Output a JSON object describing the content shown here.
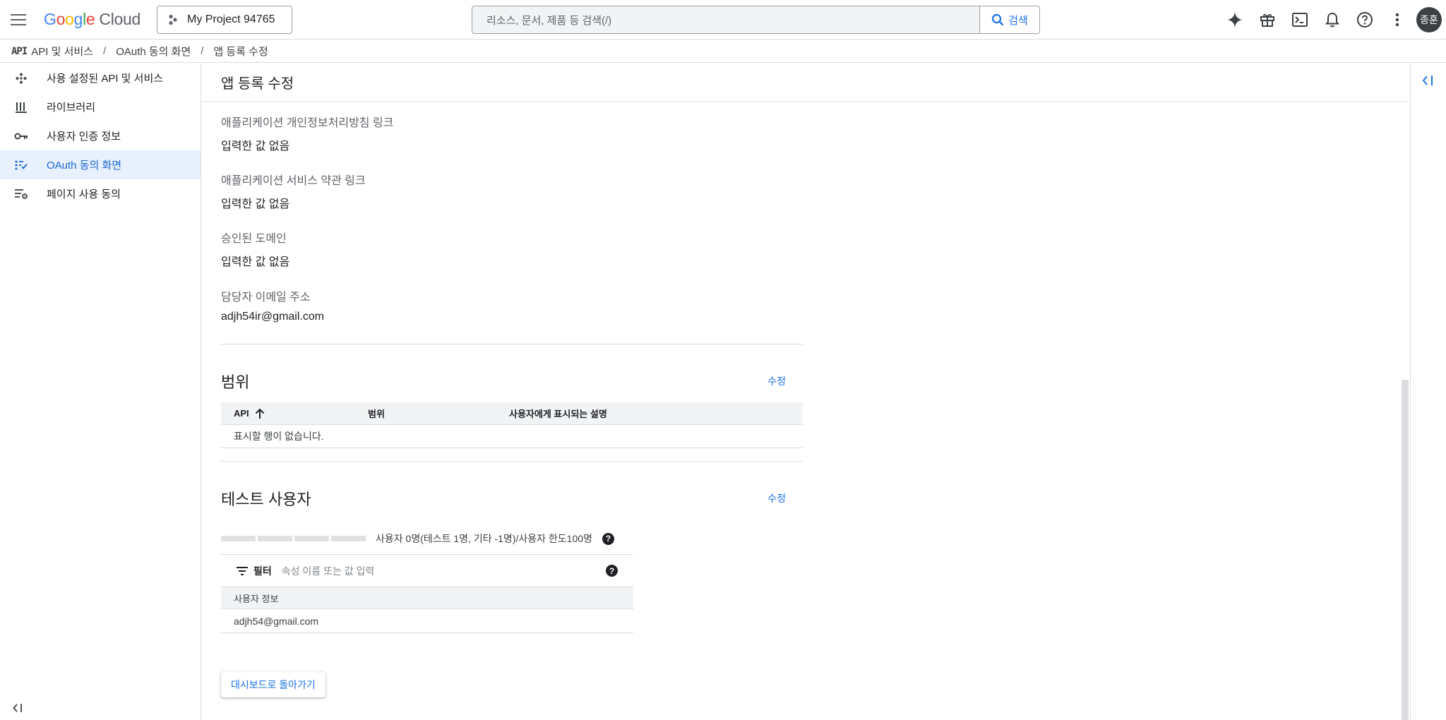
{
  "topbar": {
    "logo": {
      "g": "G",
      "o1": "o",
      "o2": "o",
      "g2": "g",
      "l": "l",
      "e": "e",
      "cloud": "Cloud"
    },
    "project_name": "My Project 94765",
    "search_placeholder": "리소스, 문서, 제품 등 검색(/)",
    "search_button": "검색",
    "avatar_text": "종훈"
  },
  "breadcrumb": {
    "api_mark": "API",
    "items": [
      "API 및 서비스",
      "OAuth 동의 화면",
      "앱 등록 수정"
    ],
    "separator": "/"
  },
  "sidebar": {
    "items": [
      {
        "label": "사용 설정된 API 및 서비스",
        "icon": "api-services-icon"
      },
      {
        "label": "라이브러리",
        "icon": "library-icon"
      },
      {
        "label": "사용자 인증 정보",
        "icon": "key-icon"
      },
      {
        "label": "OAuth 동의 화면",
        "icon": "consent-icon",
        "active": true
      },
      {
        "label": "페이지 사용 동의",
        "icon": "page-settings-icon"
      }
    ],
    "collapse_icon": "<|"
  },
  "main": {
    "title": "앱 등록 수정",
    "fields": [
      {
        "label": "애플리케이션 개인정보처리방침 링크",
        "value": "입력한 값 없음"
      },
      {
        "label": "애플리케이션 서비스 약관 링크",
        "value": "입력한 값 없음"
      },
      {
        "label": "승인된 도메인",
        "value": "입력한 값 없음"
      },
      {
        "label": "담당자 이메일 주소",
        "value": "adjh54ir@gmail.com"
      }
    ],
    "scopes": {
      "title": "범위",
      "edit": "수정",
      "columns": [
        "API",
        "범위",
        "사용자에게 표시되는 설명"
      ],
      "empty": "표시할 행이 없습니다."
    },
    "test_users": {
      "title": "테스트 사용자",
      "edit": "수정",
      "quota_text": "사용자 0명(테스트 1명, 기타 -1명)/사용자 한도100명",
      "filter_label": "필터",
      "filter_placeholder": "속성 이름 또는 값 입력",
      "column": "사용자 정보",
      "rows": [
        "adjh54@gmail.com"
      ]
    },
    "back_button": "대시보드로 돌아가기"
  },
  "colors": {
    "accent": "#1a73e8",
    "active_bg": "#e8f0fe",
    "divider": "#dadce0"
  }
}
